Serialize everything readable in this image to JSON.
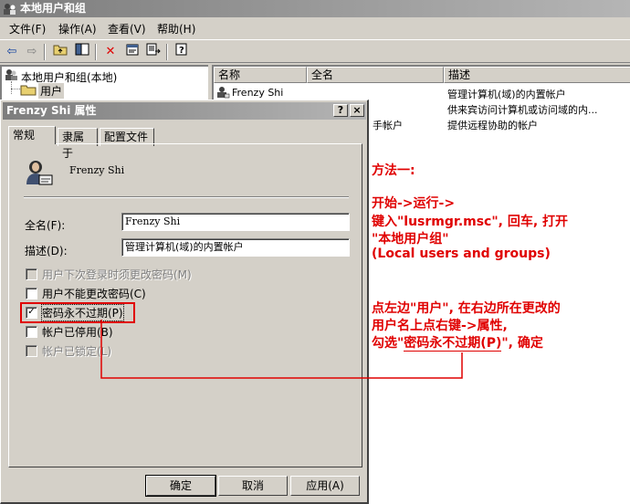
{
  "window": {
    "title": "本地用户和组"
  },
  "menu": [
    "文件(F)",
    "操作(A)",
    "查看(V)",
    "帮助(H)"
  ],
  "tree": {
    "root": "本地用户和组(本地)",
    "users": "用户"
  },
  "list": {
    "headers": [
      "名称",
      "全名",
      "描述"
    ],
    "rows": [
      {
        "name": "Frenzy Shi",
        "fullname": "",
        "desc": "管理计算机(域)的内置帐户"
      },
      {
        "name": "",
        "fullname": "",
        "desc": "供来宾访问计算机或访问域的内..."
      },
      {
        "name": "",
        "fullname": "手帐户",
        "desc": "提供远程协助的帐户"
      }
    ]
  },
  "dialog": {
    "title": "Frenzy Shi 属性",
    "help_btn": "?",
    "close_btn": "×",
    "tabs": [
      "常规",
      "隶属于",
      "配置文件"
    ],
    "username": "Frenzy Shi",
    "fullname_label": "全名(F):",
    "fullname_value": "Frenzy Shi",
    "desc_label": "描述(D):",
    "desc_value": "管理计算机(域)的内置帐户",
    "checkboxes": [
      {
        "label": "用户下次登录时须更改密码(M)",
        "checked": false,
        "enabled": false
      },
      {
        "label": "用户不能更改密码(C)",
        "checked": false,
        "enabled": true
      },
      {
        "label": "密码永不过期(P)",
        "checked": true,
        "enabled": true
      },
      {
        "label": "帐户已停用(B)",
        "checked": false,
        "enabled": true
      },
      {
        "label": "帐户已锁定(L)",
        "checked": false,
        "enabled": false
      }
    ],
    "ok": "确定",
    "cancel": "取消",
    "apply": "应用(A)"
  },
  "annotation": {
    "line1": "方法一:",
    "line2": "开始->运行->",
    "line3": "键入\"lusrmgr.msc\", 回车, 打开",
    "line4": "\"本地用户组\"",
    "line5": "(Local users and groups)",
    "line6": "点左边\"用户\", 在右边所在更改的",
    "line7": "用户名上点右键->属性,",
    "line8a": "勾选\"",
    "line8b": "密码永不过期(P)",
    "line8c": "\", 确定"
  },
  "colors": {
    "annotation": "#e00000",
    "title_gray": "#7d7d7d"
  }
}
